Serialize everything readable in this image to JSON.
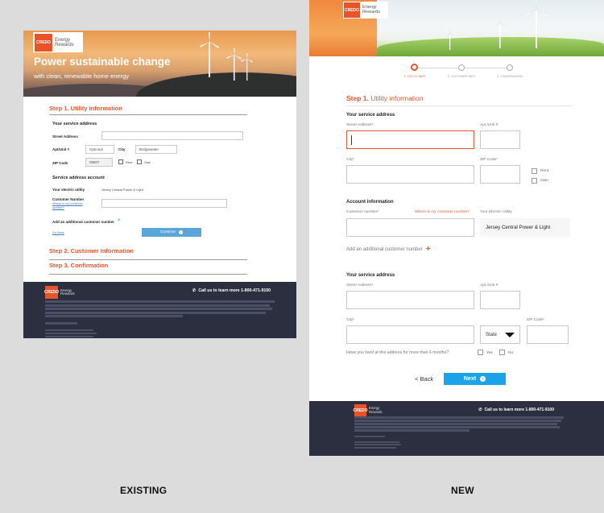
{
  "brand": {
    "logo_mark": "CREDO",
    "logo_text_line1": "Energy",
    "logo_text_line2": "Rewards",
    "accent_color": "#e8542a",
    "footer_color": "#2b2f40",
    "button_color": "#1aa3e8"
  },
  "existing": {
    "caption": "EXISTING",
    "hero_title": "Power sustainable change",
    "hero_subtitle": "with clean, renewable home energy",
    "step1_title": "Step 1. Utility Information",
    "service_address_heading": "Your service address",
    "street_label": "Street Address",
    "apt_label": "Apt/Unit #",
    "apt_placeholder": "Optional",
    "city_label": "City",
    "city_value": "Bridgewater",
    "zip_label": "ZIP Code",
    "zip_value": "08807",
    "rent_label": "Rent",
    "own_label": "Own",
    "account_heading": "Service address account",
    "utility_label": "Your electric utility",
    "utility_value": "Jersey Central Power & Light",
    "customer_number_label": "Customer Number",
    "customer_number_link": "Where is my customer number?",
    "add_customer_label": "Add an additional customer number",
    "back_link": "Go Back",
    "continue_label": "Continue",
    "step2_title": "Step 2. Customer Information",
    "step3_title": "Step 3. Confirmation",
    "footer_phone": "Call us to learn more 1-800-471-9100"
  },
  "new": {
    "caption": "NEW",
    "steps": [
      "1. UTILITY INFO",
      "2. CUSTOMER INFO",
      "3. CONFIRMATION"
    ],
    "step1_title_prefix": "Step 1.",
    "step1_title_rest": "Utility information",
    "service_address_heading": "Your service address",
    "street_label": "Street Address*",
    "apt_label": "Apt./Unit #",
    "city_label": "City*",
    "zip_label": "ZIP Code*",
    "rent_label": "Rent",
    "own_label": "Own",
    "account_heading": "Account information",
    "customer_number_label": "Customer number*",
    "customer_number_link": "Where is my customer number?",
    "utility_label": "Your Electric Utility",
    "utility_value": "Jersey Central Power & Light",
    "add_customer_label": "Add an additional customer number",
    "service_address_heading_2": "Your service address",
    "street_label_2": "Street Address*",
    "apt_label_2": "Apt./Unit #",
    "city_label_2": "City*",
    "state_value": "State",
    "zip_label_2": "ZIP Code*",
    "six_months_question": "Have you lived at this address for more than 6 months?",
    "yes_label": "Yes",
    "no_label": "No",
    "back_label": "< Back",
    "next_label": "Next",
    "footer_phone": "Call us to learn more 1-800-471-9100"
  }
}
